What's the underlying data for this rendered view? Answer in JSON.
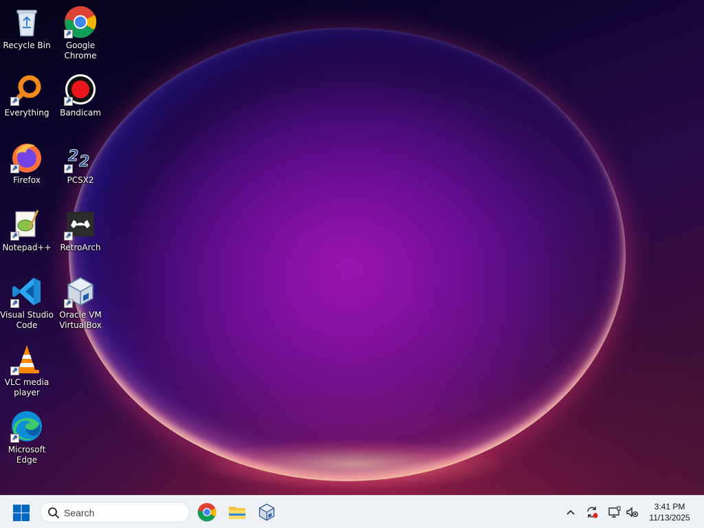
{
  "desktop": {
    "icons": [
      {
        "name": "recycle-bin",
        "label": "Recycle Bin"
      },
      {
        "name": "google-chrome",
        "label": "Google Chrome"
      },
      {
        "name": "everything",
        "label": "Everything"
      },
      {
        "name": "bandicam",
        "label": "Bandicam"
      },
      {
        "name": "firefox",
        "label": "Firefox"
      },
      {
        "name": "pcsx2",
        "label": "PCSX2"
      },
      {
        "name": "notepad-plus-plus",
        "label": "Notepad++"
      },
      {
        "name": "retroarch",
        "label": "RetroArch"
      },
      {
        "name": "visual-studio-code",
        "label": "Visual Studio Code"
      },
      {
        "name": "oracle-vm-virtualbox",
        "label": "Oracle VM VirtualBox"
      },
      {
        "name": "vlc-media-player",
        "label": "VLC media player"
      },
      {
        "name": "microsoft-edge",
        "label": "Microsoft Edge"
      }
    ]
  },
  "taskbar": {
    "search": {
      "placeholder": "Search"
    },
    "pinned_apps": [
      "chrome-icon",
      "file-explorer-icon",
      "virtualbox-icon"
    ],
    "tray_icons": [
      "chevron-up-icon",
      "sync-icon",
      "network-icon",
      "volume-muted-icon"
    ],
    "clock": {
      "time": "3:41 PM",
      "date": "11/13/2025"
    },
    "accent": "#0067c0"
  }
}
